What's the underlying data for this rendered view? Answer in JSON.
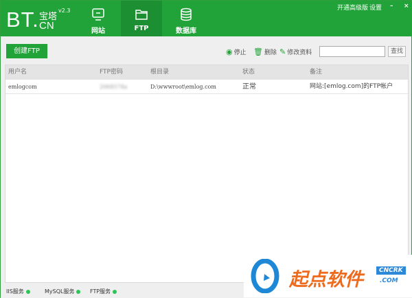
{
  "header": {
    "logo": {
      "text": "BT.",
      "cn_top": "宝塔",
      "version": "v2.3",
      "cn_bottom": "CN"
    },
    "tabs": [
      {
        "label": "网站",
        "icon": "monitor-icon"
      },
      {
        "label": "FTP",
        "icon": "folder-icon",
        "selected": true
      },
      {
        "label": "数据库",
        "icon": "database-icon"
      }
    ],
    "upgrade": "开通高级版",
    "settings": "设置"
  },
  "toolbar": {
    "create": "创建FTP",
    "stop": "停止",
    "delete": "删除",
    "edit": "修改资料",
    "search_value": "",
    "search_btn": "查找"
  },
  "table": {
    "columns": [
      "用户名",
      "FTP密码",
      "根目录",
      "状态",
      "备注"
    ],
    "rows": [
      {
        "user": "emlogcom",
        "password": "2068574a",
        "root": "D:\\wwwroot\\emlog.com",
        "status": "正常",
        "note": "网站:[emlog.com]的FTP帐户"
      }
    ]
  },
  "statusbar": [
    {
      "label": "IIS服务"
    },
    {
      "label": "MySQL服务"
    },
    {
      "label": "FTP服务"
    }
  ],
  "watermark": {
    "text": "起点软件",
    "badge": "CNCRK",
    ".com": ".COM"
  },
  "colors": {
    "brand": "#22a33a",
    "ok": "#2ec45a"
  }
}
